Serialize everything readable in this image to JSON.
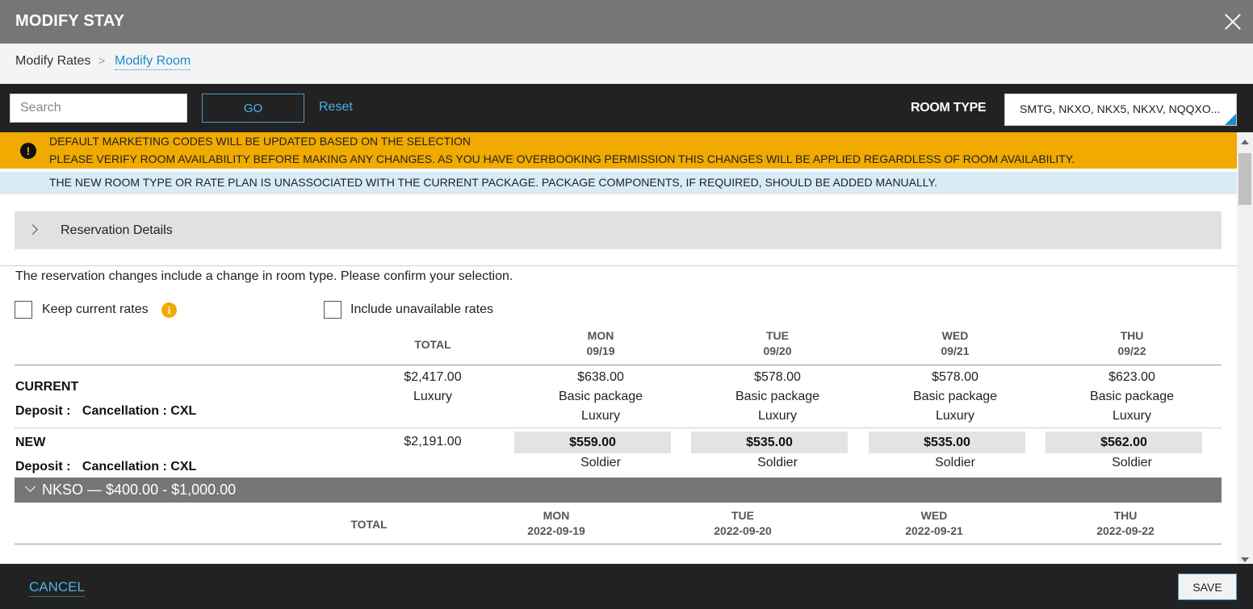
{
  "titlebar": {
    "title": "MODIFY STAY"
  },
  "breadcrumb": {
    "item1": "Modify Rates",
    "separator": ">",
    "item2": "Modify Room"
  },
  "search": {
    "placeholder": "Search",
    "go_label": "GO",
    "reset_label": "Reset"
  },
  "room_type": {
    "label": "ROOM TYPE",
    "value": "SMTG, NKXO, NKX5, NKXV, NQQXO..."
  },
  "banners": {
    "warning_line1": "DEFAULT MARKETING CODES WILL BE UPDATED BASED ON THE SELECTION",
    "warning_line2": "PLEASE VERIFY ROOM AVAILABILITY BEFORE MAKING ANY CHANGES. AS YOU HAVE OVERBOOKING PERMISSION THIS CHANGES WILL BE APPLIED REGARDLESS OF ROOM AVAILABILITY.",
    "info": "THE NEW ROOM TYPE OR RATE PLAN IS UNASSOCIATED WITH THE CURRENT PACKAGE. PACKAGE COMPONENTS, IF REQUIRED, SHOULD BE ADDED MANUALLY."
  },
  "reservation_details": {
    "label": "Reservation Details"
  },
  "message": "The reservation changes include a change in room type. Please confirm your selection.",
  "options": {
    "keep_current_rates": "Keep current rates",
    "include_unavailable": "Include unavailable rates"
  },
  "comparison": {
    "total_header": "TOTAL",
    "days": [
      {
        "day": "MON",
        "date": "09/19"
      },
      {
        "day": "TUE",
        "date": "09/20"
      },
      {
        "day": "WED",
        "date": "09/21"
      },
      {
        "day": "THU",
        "date": "09/22"
      }
    ],
    "current": {
      "label": "CURRENT",
      "deposit_label": "Deposit :",
      "cancellation": "Cancellation : CXL",
      "total": "$2,417.00",
      "total_sub": "Luxury",
      "cells": [
        {
          "amount": "$638.00",
          "package": "Basic package",
          "room": "Luxury"
        },
        {
          "amount": "$578.00",
          "package": "Basic package",
          "room": "Luxury"
        },
        {
          "amount": "$578.00",
          "package": "Basic package",
          "room": "Luxury"
        },
        {
          "amount": "$623.00",
          "package": "Basic package",
          "room": "Luxury"
        }
      ]
    },
    "new": {
      "label": "NEW",
      "deposit_label": "Deposit :",
      "cancellation": "Cancellation : CXL",
      "total": "$2,191.00",
      "cells": [
        {
          "amount": "$559.00",
          "room": "Soldier"
        },
        {
          "amount": "$535.00",
          "room": "Soldier"
        },
        {
          "amount": "$535.00",
          "room": "Soldier"
        },
        {
          "amount": "$562.00",
          "room": "Soldier"
        }
      ]
    }
  },
  "group": {
    "label": "NKSO — $400.00 - $1,000.00",
    "total_header": "TOTAL",
    "days": [
      {
        "day": "MON",
        "date": "2022-09-19"
      },
      {
        "day": "TUE",
        "date": "2022-09-20"
      },
      {
        "day": "WED",
        "date": "2022-09-21"
      },
      {
        "day": "THU",
        "date": "2022-09-22"
      }
    ]
  },
  "footer": {
    "cancel_label": "CANCEL",
    "save_label": "SAVE"
  }
}
